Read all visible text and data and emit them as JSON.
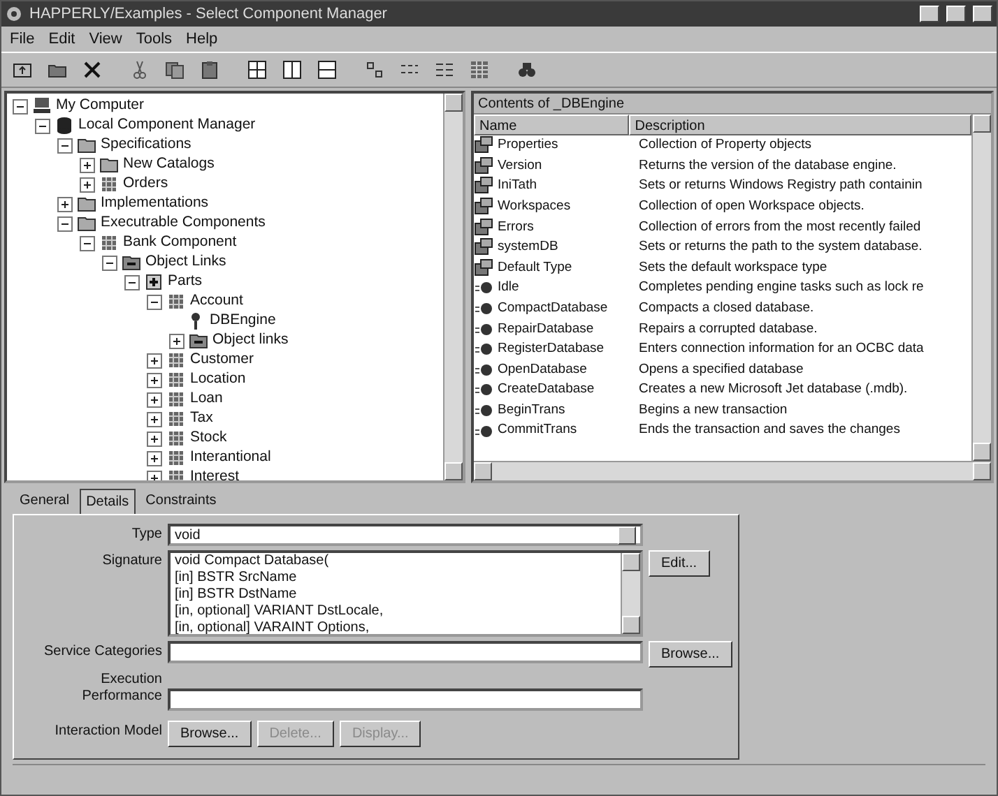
{
  "window": {
    "title": "HAPPERLY/Examples - Select Component Manager"
  },
  "menu": [
    "File",
    "Edit",
    "View",
    "Tools",
    "Help"
  ],
  "toolbar": [
    {
      "kind": "up"
    },
    {
      "kind": "folder"
    },
    {
      "kind": "delete"
    },
    {
      "kind": "sep"
    },
    {
      "kind": "cut"
    },
    {
      "kind": "copy"
    },
    {
      "kind": "paste"
    },
    {
      "kind": "sep"
    },
    {
      "kind": "pane4"
    },
    {
      "kind": "pane2v"
    },
    {
      "kind": "pane2h"
    },
    {
      "kind": "sep"
    },
    {
      "kind": "largeicons"
    },
    {
      "kind": "smallicons"
    },
    {
      "kind": "list"
    },
    {
      "kind": "details"
    },
    {
      "kind": "sep"
    },
    {
      "kind": "find"
    }
  ],
  "tree": [
    {
      "label": "My Computer",
      "kind": "computer",
      "expanded": true,
      "children": [
        {
          "label": "Local Component Manager",
          "kind": "database",
          "expanded": true,
          "children": [
            {
              "label": "Specifications",
              "kind": "folder",
              "expanded": true,
              "children": [
                {
                  "label": "New Catalogs",
                  "kind": "folder",
                  "expanded": false
                },
                {
                  "label": "Orders",
                  "kind": "component",
                  "expanded": false
                }
              ]
            },
            {
              "label": "Implementations",
              "kind": "folder",
              "expanded": false
            },
            {
              "label": "Executrable Components",
              "kind": "folder",
              "expanded": true,
              "children": [
                {
                  "label": "Bank Component",
                  "kind": "component",
                  "expanded": true,
                  "children": [
                    {
                      "label": "Object Links",
                      "kind": "links",
                      "expanded": true,
                      "children": [
                        {
                          "label": "Parts",
                          "kind": "parts",
                          "expanded": true,
                          "children": [
                            {
                              "label": "Account",
                              "kind": "component",
                              "expanded": true,
                              "children": [
                                {
                                  "label": "DBEngine",
                                  "kind": "key"
                                },
                                {
                                  "label": "Object links",
                                  "kind": "links",
                                  "expanded": false
                                }
                              ]
                            },
                            {
                              "label": "Customer",
                              "kind": "component",
                              "expanded": false
                            },
                            {
                              "label": "Location",
                              "kind": "component",
                              "expanded": false
                            },
                            {
                              "label": "Loan",
                              "kind": "component",
                              "expanded": false
                            },
                            {
                              "label": "Tax",
                              "kind": "component",
                              "expanded": false
                            },
                            {
                              "label": "Stock",
                              "kind": "component",
                              "expanded": false
                            },
                            {
                              "label": "Interantional",
                              "kind": "component",
                              "expanded": false
                            },
                            {
                              "label": "Interest",
                              "kind": "component",
                              "expanded": false
                            }
                          ]
                        }
                      ]
                    }
                  ]
                }
              ]
            }
          ]
        }
      ]
    }
  ],
  "contents": {
    "title": "Contents of _DBEngine",
    "columns": [
      "Name",
      "Description"
    ],
    "rows": [
      {
        "kind": "property",
        "name": "Properties",
        "description": "Collection of Property objects"
      },
      {
        "kind": "property",
        "name": "Version",
        "description": "Returns the  version of the database engine."
      },
      {
        "kind": "property",
        "name": "IniTath",
        "description": "Sets or returns Windows Registry path containin"
      },
      {
        "kind": "property",
        "name": "Workspaces",
        "description": "Collection of open Workspace objects."
      },
      {
        "kind": "property",
        "name": "Errors",
        "description": "Collection of errors from the most recently failed"
      },
      {
        "kind": "property",
        "name": "systemDB",
        "description": "Sets or returns the path to the system database."
      },
      {
        "kind": "property",
        "name": "Default Type",
        "description": "Sets the default workspace type"
      },
      {
        "kind": "method",
        "name": "Idle",
        "description": "Completes pending engine tasks such as lock re"
      },
      {
        "kind": "method",
        "name": "CompactDatabase",
        "description": "Compacts a closed database."
      },
      {
        "kind": "method",
        "name": "RepairDatabase",
        "description": "Repairs a corrupted database."
      },
      {
        "kind": "method",
        "name": "RegisterDatabase",
        "description": "Enters connection information for an OCBC data"
      },
      {
        "kind": "method",
        "name": "OpenDatabase",
        "description": "Opens a specified database"
      },
      {
        "kind": "method",
        "name": "CreateDatabase",
        "description": "Creates a new Microsoft Jet database (.mdb)."
      },
      {
        "kind": "method",
        "name": "BeginTrans",
        "description": "Begins a new transaction"
      },
      {
        "kind": "method",
        "name": "CommitTrans",
        "description": "Ends the transaction and saves the changes"
      }
    ]
  },
  "tabs": [
    {
      "label": "General",
      "selected": false
    },
    {
      "label": "Details",
      "selected": true
    },
    {
      "label": "Constraints",
      "selected": false
    }
  ],
  "details": {
    "type_label": "Type",
    "type_value": "void",
    "signature_label": "Signature",
    "signature_lines": [
      "void Compact Database(",
      "[in] BSTR SrcName",
      "[in] BSTR DstName",
      "[in, optional] VARIANT DstLocale,",
      "[in, optional] VARAINT Options,"
    ],
    "edit_button": "Edit...",
    "service_label": "Service Categories",
    "service_button": "Browse...",
    "performance_label": [
      "Execution",
      "Performance"
    ],
    "interaction_label": "Interaction Model",
    "interaction_buttons": [
      {
        "label": "Browse...",
        "disabled": false
      },
      {
        "label": "Delete...",
        "disabled": true
      },
      {
        "label": "Display...",
        "disabled": true
      }
    ]
  }
}
